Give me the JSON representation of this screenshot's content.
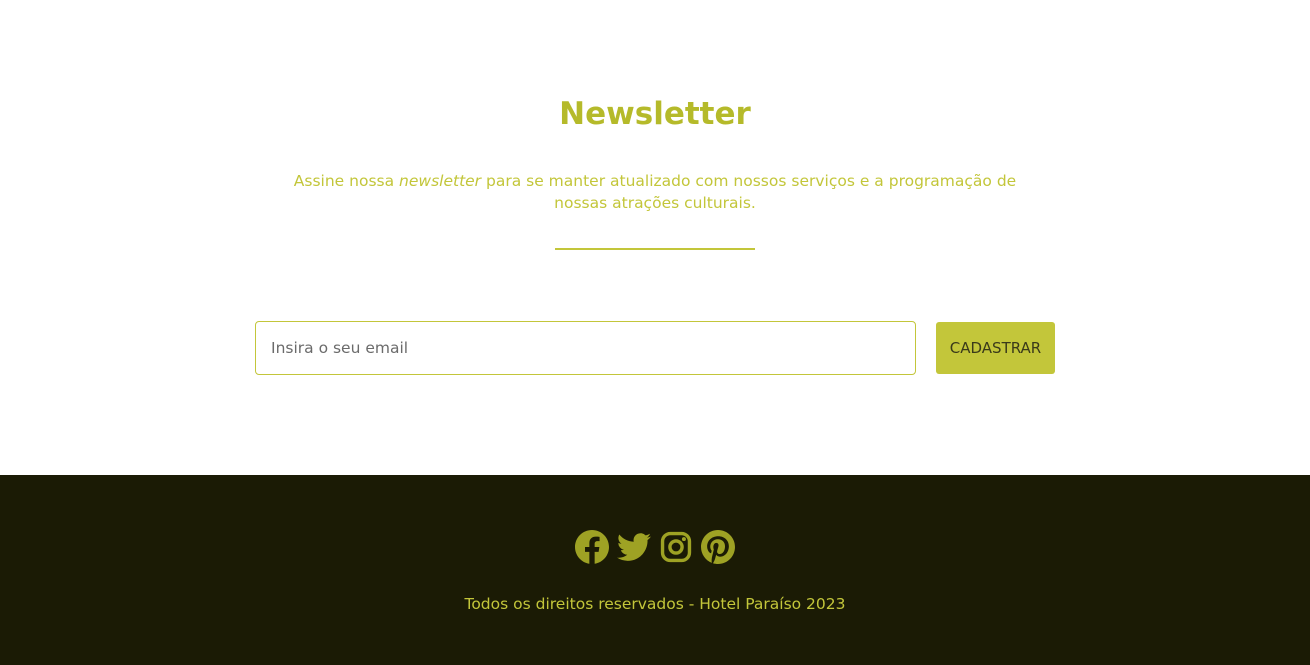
{
  "newsletter": {
    "title": "Newsletter",
    "text_before": "Assine nossa ",
    "text_emphasis": "newsletter",
    "text_after": " para se manter atualizado com nossos serviços e a programação de nossas atrações culturais.",
    "email_placeholder": "Insira o seu email",
    "email_value": "",
    "submit_label": "CADASTRAR"
  },
  "footer": {
    "social": [
      {
        "icon": "facebook-icon"
      },
      {
        "icon": "twitter-icon"
      },
      {
        "icon": "instagram-icon"
      },
      {
        "icon": "pinterest-icon"
      }
    ],
    "copyright": "Todos os direitos reservados - Hotel Paraíso 2023"
  },
  "colors": {
    "accent": "#c3c63a",
    "title": "#b5ba2a",
    "footer_bg": "#1b1b05",
    "icons": "#9ea224"
  }
}
